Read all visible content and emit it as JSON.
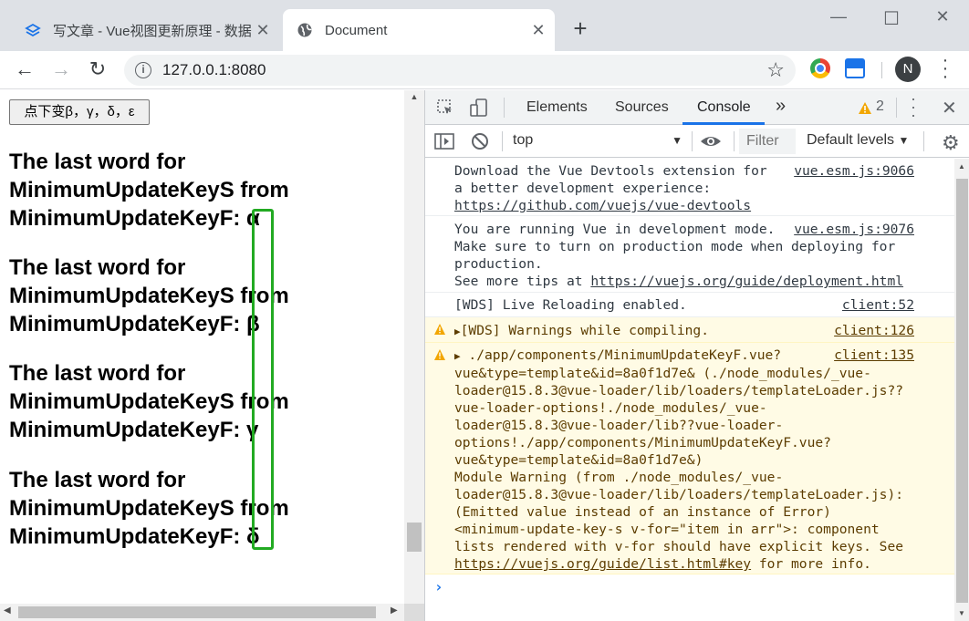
{
  "browser": {
    "tabs": [
      {
        "title": "写文章 - Vue视图更新原理 - 数据",
        "close": "✕",
        "active": false
      },
      {
        "title": "Document",
        "close": "✕",
        "active": true
      }
    ],
    "new_tab": "+",
    "window": {
      "minimize": "—",
      "maximize": "☐",
      "close": "✕"
    },
    "nav": {
      "back": "←",
      "forward": "→",
      "reload": "↻"
    },
    "url": "127.0.0.1:8080",
    "avatar_initial": "N"
  },
  "page": {
    "button_label": "点下变β，γ，δ，ε",
    "blocks": [
      {
        "line1": "The last word for",
        "line2": "MinimumUpdateKeyS from",
        "line3_prefix": "MinimumUpdateKeyF: ",
        "letter": "α"
      },
      {
        "line1": "The last word for",
        "line2": "MinimumUpdateKeyS from",
        "line3_prefix": "MinimumUpdateKeyF: ",
        "letter": "β"
      },
      {
        "line1": "The last word for",
        "line2": "MinimumUpdateKeyS from",
        "line3_prefix": "MinimumUpdateKeyF: ",
        "letter": "γ"
      },
      {
        "line1": "The last word for",
        "line2": "MinimumUpdateKeyS from",
        "line3_prefix": "MinimumUpdateKeyF: ",
        "letter": "δ"
      }
    ],
    "highlight_color": "#22aa22"
  },
  "devtools": {
    "tabs": {
      "elements": "Elements",
      "sources": "Sources",
      "console": "Console",
      "more": "»"
    },
    "warning_count": "2",
    "context": "top",
    "filter_placeholder": "Filter",
    "levels": "Default levels",
    "messages": [
      {
        "text": "Download the Vue Devtools extension for\na better development experience:\n",
        "link": "https://github.com/vuejs/vue-devtools",
        "source": "vue.esm.js:9066"
      },
      {
        "text": "You are running Vue in development mode.\nMake sure to turn on production mode when deploying for\nproduction.\nSee more tips at ",
        "link": "https://vuejs.org/guide/deployment.html",
        "source": "vue.esm.js:9076"
      },
      {
        "text": "[WDS] Live Reloading enabled.",
        "source": "client:52"
      },
      {
        "text": "[WDS] Warnings while compiling.",
        "source": "client:126",
        "level": "warning"
      },
      {
        "text": "./app/components/MinimumUpdateKeyF.vue?\nvue&type=template&id=8a0f1d7e& (./node_modules/_vue-\nloader@15.8.3@vue-loader/lib/loaders/templateLoader.js??\nvue-loader-options!./node_modules/_vue-\nloader@15.8.3@vue-loader/lib??vue-loader-\noptions!./app/components/MinimumUpdateKeyF.vue?\nvue&type=template&id=8a0f1d7e&)\nModule Warning (from ./node_modules/_vue-\nloader@15.8.3@vue-loader/lib/loaders/templateLoader.js):\n(Emitted value instead of an instance of Error)\n<minimum-update-key-s v-for=\"item in arr\">: component\nlists rendered with v-for should have explicit keys. See\n",
        "link": "https://vuejs.org/guide/list.html#key",
        "after_link": " for more info.",
        "source": "client:135",
        "level": "warning"
      }
    ],
    "prompt": "›"
  }
}
